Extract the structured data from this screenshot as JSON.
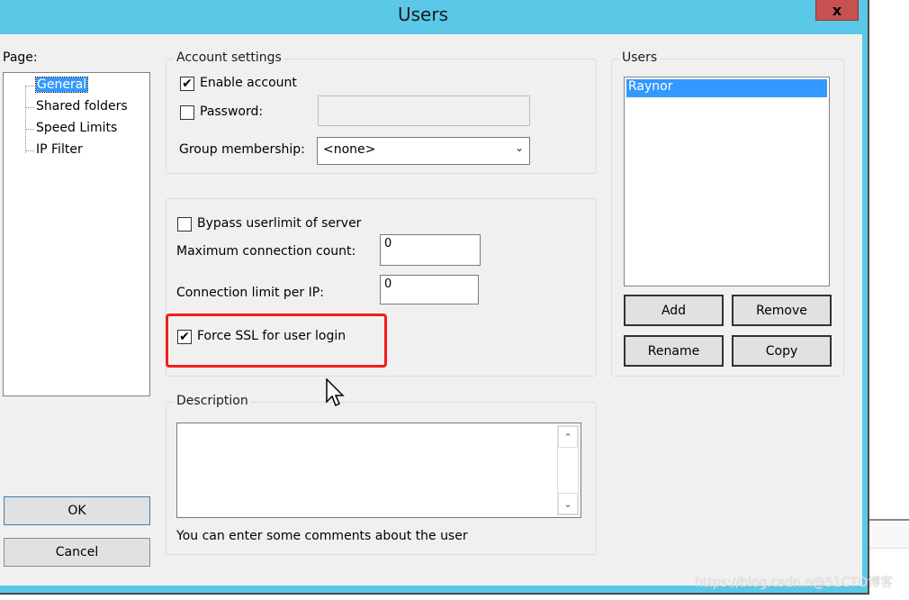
{
  "window": {
    "title": "Users",
    "close_label": "x"
  },
  "page_panel": {
    "label": "Page:",
    "items": [
      {
        "label": "General",
        "selected": true
      },
      {
        "label": "Shared folders",
        "selected": false
      },
      {
        "label": "Speed Limits",
        "selected": false
      },
      {
        "label": "IP Filter",
        "selected": false
      }
    ]
  },
  "account_settings": {
    "title": "Account settings",
    "enable_account": {
      "label": "Enable account",
      "checked": true
    },
    "password": {
      "label": "Password:",
      "checked": false,
      "value": ""
    },
    "group_membership": {
      "label": "Group membership:",
      "value": "<none>"
    }
  },
  "connection": {
    "bypass_userlimit": {
      "label": "Bypass userlimit of server",
      "checked": false
    },
    "max_connection": {
      "label": "Maximum connection count:",
      "value": "0"
    },
    "limit_per_ip": {
      "label": "Connection limit per IP:",
      "value": "0"
    },
    "force_ssl": {
      "label": "Force SSL for user login",
      "checked": true
    }
  },
  "description": {
    "title": "Description",
    "value": "",
    "hint": "You can enter some comments about the user"
  },
  "users_panel": {
    "title": "Users",
    "list": [
      {
        "name": "Raynor",
        "selected": true
      }
    ],
    "buttons": {
      "add": "Add",
      "remove": "Remove",
      "rename": "Rename",
      "copy": "Copy"
    }
  },
  "dialog_buttons": {
    "ok": "OK",
    "cancel": "Cancel"
  },
  "watermark": "https://blog.csdn.n@51CTO博客",
  "colors": {
    "titlebar": "#5bc8e8",
    "close": "#c75050",
    "selection": "#3399ff",
    "highlight_box": "#f21d1d"
  }
}
